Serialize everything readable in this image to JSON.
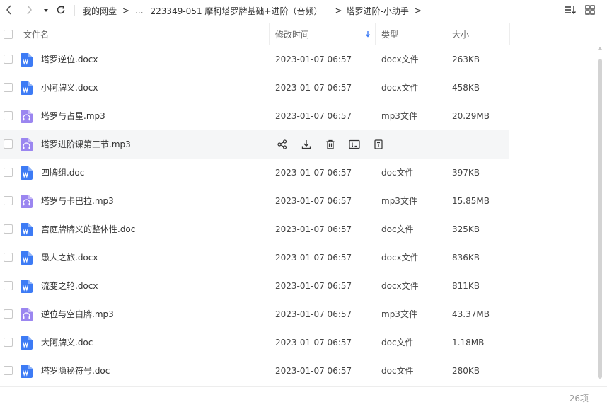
{
  "nav": {
    "back_icon": "chevron-left-icon",
    "forward_icon": "chevron-right-icon",
    "history_icon": "caret-down-icon",
    "refresh_icon": "refresh-icon",
    "sort_icon": "sort-icon",
    "grid_icon": "grid-view-icon"
  },
  "breadcrumb": {
    "root": "我的网盘",
    "ellipsis": "...",
    "folder1": "223349-051 摩柯塔罗牌基础+进阶（音频）",
    "folder2": "塔罗进阶-小助手",
    "sep": ">"
  },
  "header": {
    "name": "文件名",
    "modified": "修改时间",
    "type": "类型",
    "size": "大小"
  },
  "files": [
    {
      "name": "塔罗逆位.docx",
      "date": "2023-01-07 06:57",
      "type": "docx文件",
      "size": "263KB",
      "kind": "doc"
    },
    {
      "name": "小阿牌义.docx",
      "date": "2023-01-07 06:57",
      "type": "docx文件",
      "size": "458KB",
      "kind": "doc"
    },
    {
      "name": "塔罗与占星.mp3",
      "date": "2023-01-07 06:57",
      "type": "mp3文件",
      "size": "20.29MB",
      "kind": "audio"
    },
    {
      "name": "塔罗进阶课第三节.mp3",
      "date": "",
      "type": "",
      "size": "",
      "kind": "audio"
    },
    {
      "name": "四牌组.doc",
      "date": "2023-01-07 06:57",
      "type": "doc文件",
      "size": "397KB",
      "kind": "doc"
    },
    {
      "name": "塔罗与卡巴拉.mp3",
      "date": "2023-01-07 06:57",
      "type": "mp3文件",
      "size": "15.85MB",
      "kind": "audio"
    },
    {
      "name": "宫庭牌牌义的整体性.doc",
      "date": "2023-01-07 06:57",
      "type": "doc文件",
      "size": "325KB",
      "kind": "doc"
    },
    {
      "name": "愚人之旅.docx",
      "date": "2023-01-07 06:57",
      "type": "docx文件",
      "size": "836KB",
      "kind": "doc"
    },
    {
      "name": "流变之轮.docx",
      "date": "2023-01-07 06:57",
      "type": "docx文件",
      "size": "811KB",
      "kind": "doc"
    },
    {
      "name": "逆位与空白牌.mp3",
      "date": "2023-01-07 06:57",
      "type": "mp3文件",
      "size": "43.37MB",
      "kind": "audio"
    },
    {
      "name": "大阿牌义.doc",
      "date": "2023-01-07 06:57",
      "type": "doc文件",
      "size": "1.18MB",
      "kind": "doc"
    },
    {
      "name": "塔罗隐秘符号.doc",
      "date": "2023-01-07 06:57",
      "type": "doc文件",
      "size": "280KB",
      "kind": "doc"
    }
  ],
  "row_actions": [
    "share-icon",
    "download-icon",
    "delete-icon",
    "rename-icon",
    "more-icon"
  ],
  "footer": {
    "count": "26项"
  },
  "colors": {
    "doc_icon": "#3d7bf5",
    "audio_icon": "#9b86f0",
    "sort_arrow": "#3d7bf5"
  }
}
